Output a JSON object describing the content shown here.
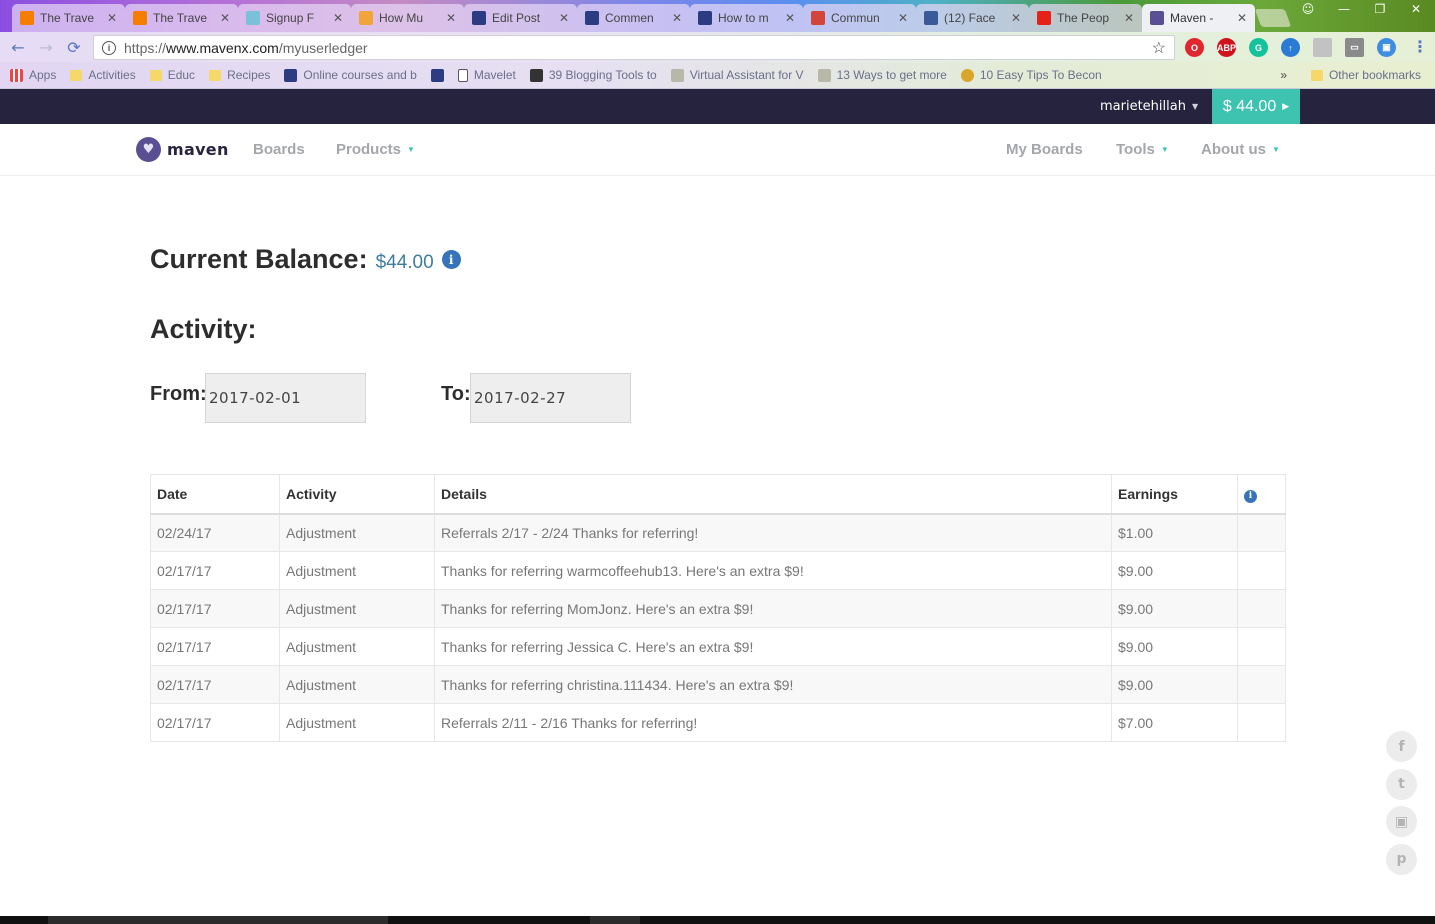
{
  "browser": {
    "tabs": [
      {
        "label": "The Trave",
        "favicon": "blogger-icon",
        "color": "#f57d00"
      },
      {
        "label": "The Trave",
        "favicon": "blogger-icon",
        "color": "#f57d00"
      },
      {
        "label": "Signup F",
        "favicon": "signup-icon",
        "color": "#7ac0d8"
      },
      {
        "label": "How Mu",
        "favicon": "how-much-icon",
        "color": "#f0a43a"
      },
      {
        "label": "Edit Post",
        "favicon": "grid-icon",
        "color": "#2b3c82"
      },
      {
        "label": "Commen",
        "favicon": "grid-icon",
        "color": "#2b3c82"
      },
      {
        "label": "How to m",
        "favicon": "grid-icon",
        "color": "#2b3c82"
      },
      {
        "label": "Commun",
        "favicon": "community-icon",
        "color": "#d2453a"
      },
      {
        "label": "(12) Face",
        "favicon": "facebook-icon",
        "color": "#3b5998"
      },
      {
        "label": "The Peop",
        "favicon": "youtube-icon",
        "color": "#e62117"
      },
      {
        "label": "Maven -",
        "favicon": "maven-icon",
        "color": "#5b4f94",
        "active": true
      }
    ],
    "url": {
      "scheme": "https://",
      "host": "www.mavenx.com",
      "path": "/myuserledger"
    },
    "extensions": [
      {
        "name": "opera-icon",
        "glyph": "O",
        "color": "#e0262f"
      },
      {
        "name": "adblock-icon",
        "glyph": "ABP",
        "color": "#d0121a"
      },
      {
        "name": "grammarly-icon",
        "glyph": "G",
        "color": "#15c39a"
      },
      {
        "name": "extension-flame-icon",
        "glyph": "↑",
        "color": "#2a7bd4"
      },
      {
        "name": "extension-gray-icon",
        "glyph": "",
        "color": "#c2c2c2"
      },
      {
        "name": "cast-icon",
        "glyph": "▭",
        "color": "#8a8a8a"
      },
      {
        "name": "extension-blue-icon",
        "glyph": "▣",
        "color": "#3f8de0"
      }
    ],
    "bookmarks": [
      {
        "label": "Apps",
        "icon": "apps-icon"
      },
      {
        "label": "Activities",
        "icon": "folder-icon"
      },
      {
        "label": "Educ",
        "icon": "folder-icon"
      },
      {
        "label": "Recipes",
        "icon": "folder-icon"
      },
      {
        "label": "Online courses and b",
        "icon": "grid-icon"
      },
      {
        "label": "",
        "icon": "grid-icon"
      },
      {
        "label": "Mavelet",
        "icon": "page-icon"
      },
      {
        "label": "39 Blogging Tools to",
        "icon": "buffer-icon"
      },
      {
        "label": "Virtual Assistant for V",
        "icon": "quote-icon"
      },
      {
        "label": "13 Ways to get more",
        "icon": "quote-icon"
      },
      {
        "label": "10 Easy Tips To Becon",
        "icon": "mask-icon"
      }
    ],
    "bookmarks_more": "»",
    "other_bookmarks": "Other bookmarks"
  },
  "site": {
    "topbar": {
      "username": "marietehillah",
      "balance_button": "$ 44.00"
    },
    "nav": {
      "logo_text": "maven",
      "left": [
        {
          "label": "Boards",
          "dropdown": false
        },
        {
          "label": "Products",
          "dropdown": true
        }
      ],
      "right": [
        {
          "label": "My Boards",
          "dropdown": false
        },
        {
          "label": "Tools",
          "dropdown": true
        },
        {
          "label": "About us",
          "dropdown": true
        }
      ]
    },
    "balance": {
      "label": "Current Balance:",
      "amount": "$44.00"
    },
    "activity": {
      "heading": "Activity:",
      "from_label": "From:",
      "from_value": "2017-02-01",
      "to_label": "To:",
      "to_value": "2017-02-27"
    },
    "table": {
      "columns": [
        "Date",
        "Activity",
        "Details",
        "Earnings",
        ""
      ],
      "rows": [
        {
          "date": "02/24/17",
          "activity": "Adjustment",
          "details": "Referrals 2/17 - 2/24 Thanks for referring!",
          "earnings": "$1.00"
        },
        {
          "date": "02/17/17",
          "activity": "Adjustment",
          "details": "Thanks for referring warmcoffeehub13. Here's an extra $9!",
          "earnings": "$9.00"
        },
        {
          "date": "02/17/17",
          "activity": "Adjustment",
          "details": "Thanks for referring MomJonz. Here's an extra $9!",
          "earnings": "$9.00"
        },
        {
          "date": "02/17/17",
          "activity": "Adjustment",
          "details": "Thanks for referring Jessica C. Here's an extra $9!",
          "earnings": "$9.00"
        },
        {
          "date": "02/17/17",
          "activity": "Adjustment",
          "details": "Thanks for referring christina.111434. Here's an extra $9!",
          "earnings": "$9.00"
        },
        {
          "date": "02/17/17",
          "activity": "Adjustment",
          "details": "Referrals 2/11 - 2/16 Thanks for referring!",
          "earnings": "$7.00"
        }
      ]
    },
    "social": [
      {
        "name": "facebook-icon",
        "glyph": "f"
      },
      {
        "name": "twitter-icon",
        "glyph": "t"
      },
      {
        "name": "instagram-icon",
        "glyph": "▣"
      },
      {
        "name": "pinterest-icon",
        "glyph": "p"
      }
    ],
    "colors": {
      "accent": "#3ec3b0",
      "topbar": "#26233f",
      "brand": "#5b4f94",
      "info": "#3673b8",
      "balance_amount": "#3f7da0"
    }
  }
}
